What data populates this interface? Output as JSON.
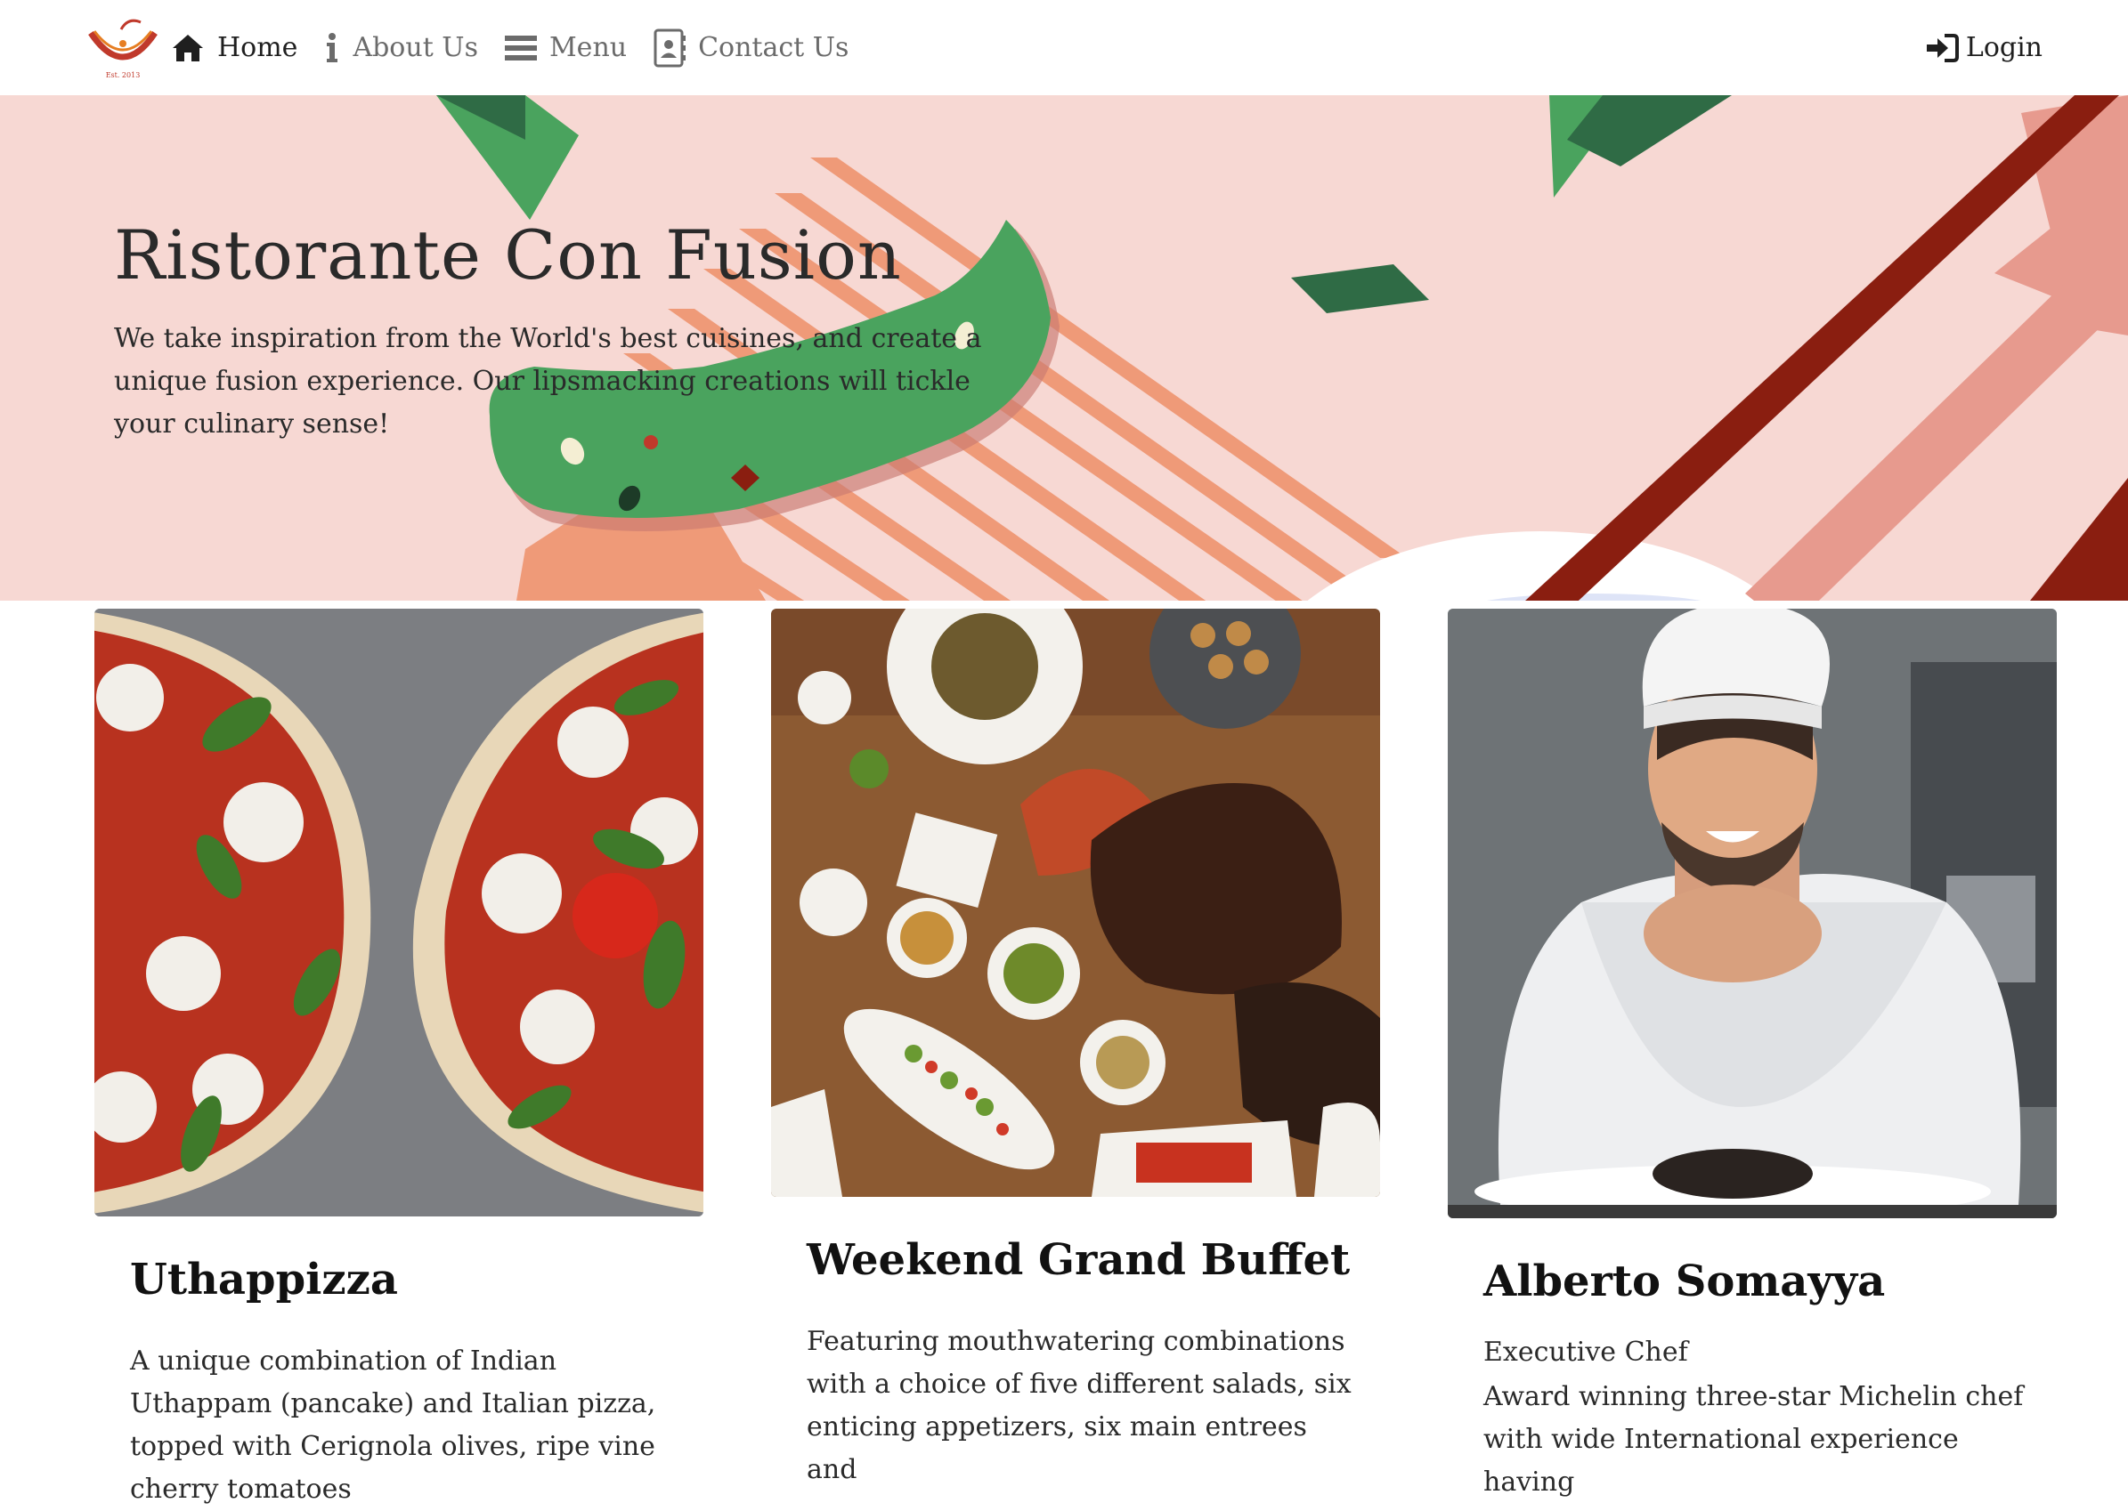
{
  "navbar": {
    "items": [
      {
        "label": "Home",
        "icon": "home-icon"
      },
      {
        "label": "About Us",
        "icon": "info-icon"
      },
      {
        "label": "Menu",
        "icon": "list-icon"
      },
      {
        "label": "Contact Us",
        "icon": "address-card-icon"
      }
    ],
    "login_label": "Login",
    "logo_text": "Est. 2013"
  },
  "hero": {
    "title": "Ristorante Con Fusion",
    "text": "We take inspiration from the World's best cuisines, and create a unique fusion experience. Our lipsmacking creations will tickle your culinary sense!"
  },
  "cards": [
    {
      "title": "Uthappizza",
      "subtitle": "",
      "text": "A unique combination of Indian Uthappam (pancake) and Italian pizza, topped with Cerignola olives, ripe vine cherry tomatoes"
    },
    {
      "title": "Weekend Grand Buffet",
      "subtitle": "",
      "text": "Featuring mouthwatering combinations with a choice of five different salads, six enticing appetizers, six main entrees and"
    },
    {
      "title": "Alberto Somayya",
      "subtitle": "Executive Chef",
      "text": "Award winning three-star Michelin chef with wide International experience having"
    }
  ],
  "colors": {
    "jumbotron_bg": "#f7d8d3",
    "stripe_orange": "#ef9a78",
    "leaf_green": "#4aa35e",
    "dark_green": "#2f6b45",
    "chopstick_red": "#8a1e10"
  }
}
